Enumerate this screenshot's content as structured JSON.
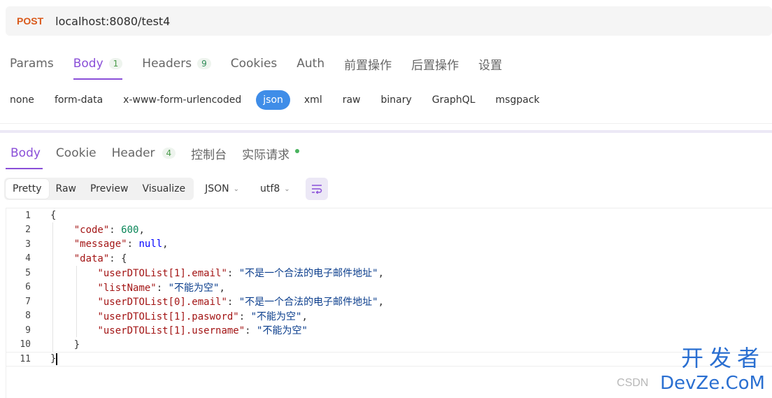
{
  "request": {
    "method": "POST",
    "url": "localhost:8080/test4"
  },
  "request_tabs": [
    {
      "label": "Params",
      "badge": null,
      "active": false
    },
    {
      "label": "Body",
      "badge": "1",
      "active": true
    },
    {
      "label": "Headers",
      "badge": "9",
      "active": false
    },
    {
      "label": "Cookies",
      "badge": null,
      "active": false
    },
    {
      "label": "Auth",
      "badge": null,
      "active": false
    },
    {
      "label": "前置操作",
      "badge": null,
      "active": false
    },
    {
      "label": "后置操作",
      "badge": null,
      "active": false
    },
    {
      "label": "设置",
      "badge": null,
      "active": false
    }
  ],
  "body_types": [
    "none",
    "form-data",
    "x-www-form-urlencoded",
    "json",
    "xml",
    "raw",
    "binary",
    "GraphQL",
    "msgpack"
  ],
  "body_type_selected": "json",
  "response_tabs": {
    "body": "Body",
    "cookie": "Cookie",
    "header": "Header",
    "header_count": "4",
    "console": "控制台",
    "actual_request": "实际请求"
  },
  "view_modes": [
    "Pretty",
    "Raw",
    "Preview",
    "Visualize"
  ],
  "view_mode_selected": "Pretty",
  "format_select": "JSON",
  "encoding_select": "utf8",
  "code_lines": [
    {
      "n": "1",
      "text": "{"
    },
    {
      "n": "2",
      "text": "    \"code\": 600,"
    },
    {
      "n": "3",
      "text": "    \"message\": null,"
    },
    {
      "n": "4",
      "text": "    \"data\": {"
    },
    {
      "n": "5",
      "text": "        \"userDTOList[1].email\": \"不是一个合法的电子邮件地址\","
    },
    {
      "n": "6",
      "text": "        \"listName\": \"不能为空\","
    },
    {
      "n": "7",
      "text": "        \"userDTOList[0].email\": \"不是一个合法的电子邮件地址\","
    },
    {
      "n": "8",
      "text": "        \"userDTOList[1].pasword\": \"不能为空\","
    },
    {
      "n": "9",
      "text": "        \"userDTOList[1].username\": \"不能为空\""
    },
    {
      "n": "10",
      "text": "    }"
    },
    {
      "n": "11",
      "text": "}"
    }
  ],
  "watermark": {
    "cn": "开发者",
    "en": "DevZe.CoM",
    "csdn": "CSDN"
  },
  "colors": {
    "accent": "#8a4fd8",
    "method": "#d9591a",
    "selected_pill": "#3f8de8",
    "status_dot": "#49b35e"
  }
}
